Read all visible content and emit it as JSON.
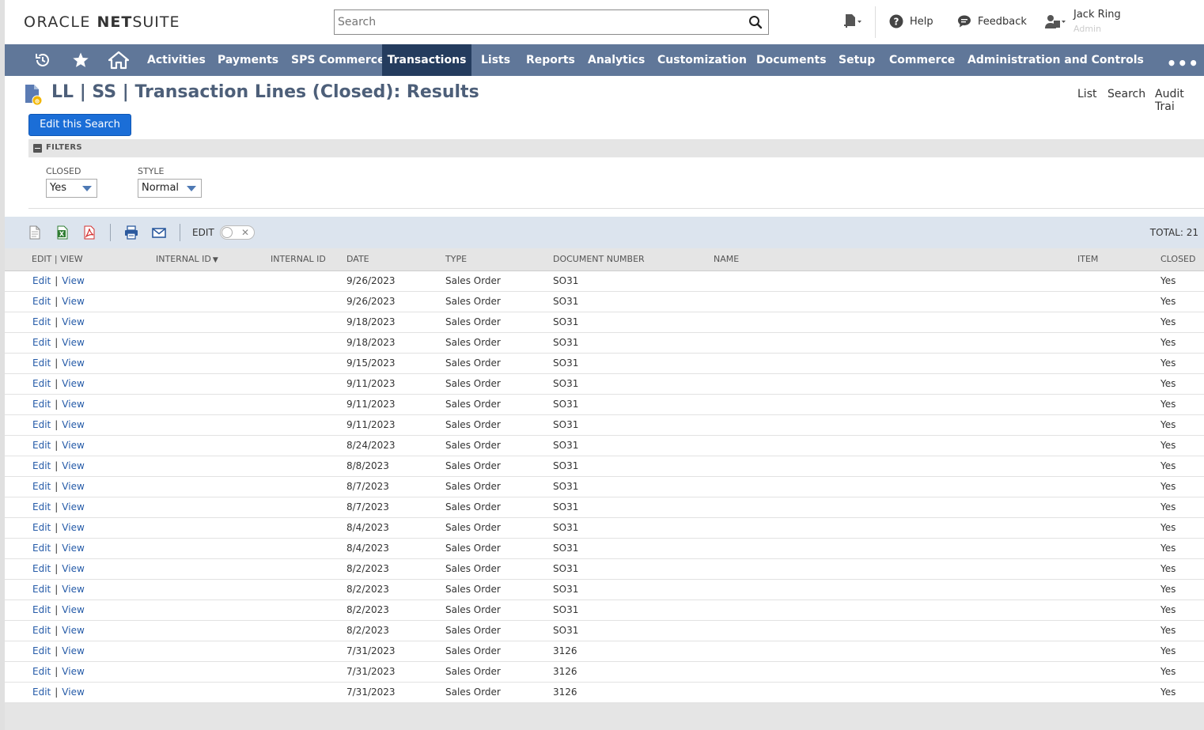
{
  "header": {
    "logo_oracle": "ORACLE",
    "logo_net": "NET",
    "logo_suite": "SUITE",
    "search_placeholder": "Search",
    "help_label": "Help",
    "feedback_label": "Feedback",
    "user_name": "Jack Ring",
    "user_role": "Admin"
  },
  "nav": {
    "items": [
      "Activities",
      "Payments",
      "SPS Commerce",
      "Transactions",
      "Lists",
      "Reports",
      "Analytics",
      "Customization",
      "Documents",
      "Setup",
      "Commerce",
      "Administration and Controls"
    ],
    "active": "Transactions",
    "more_label": "•••"
  },
  "page": {
    "title": "LL | SS | Transaction Lines (Closed): Results",
    "links": [
      "List",
      "Search",
      "Audit Trai"
    ],
    "edit_search_label": "Edit this Search"
  },
  "filters": {
    "section_label": "FILTERS",
    "closed_label": "CLOSED",
    "closed_value": "Yes",
    "style_label": "STYLE",
    "style_value": "Normal"
  },
  "toolbar": {
    "edit_label": "EDIT",
    "total_label": "TOTAL: 21"
  },
  "table": {
    "columns": [
      "EDIT | VIEW",
      "INTERNAL ID",
      "INTERNAL ID",
      "DATE",
      "TYPE",
      "DOCUMENT NUMBER",
      "NAME",
      "ITEM",
      "CLOSED"
    ],
    "sort_indicator": "▼",
    "edit_label": "Edit",
    "view_label": "View",
    "rows": [
      {
        "date": "9/26/2023",
        "type": "Sales Order",
        "doc": "SO31",
        "closed": "Yes"
      },
      {
        "date": "9/26/2023",
        "type": "Sales Order",
        "doc": "SO31",
        "closed": "Yes"
      },
      {
        "date": "9/18/2023",
        "type": "Sales Order",
        "doc": "SO31",
        "closed": "Yes"
      },
      {
        "date": "9/18/2023",
        "type": "Sales Order",
        "doc": "SO31",
        "closed": "Yes"
      },
      {
        "date": "9/15/2023",
        "type": "Sales Order",
        "doc": "SO31",
        "closed": "Yes"
      },
      {
        "date": "9/11/2023",
        "type": "Sales Order",
        "doc": "SO31",
        "closed": "Yes"
      },
      {
        "date": "9/11/2023",
        "type": "Sales Order",
        "doc": "SO31",
        "closed": "Yes"
      },
      {
        "date": "9/11/2023",
        "type": "Sales Order",
        "doc": "SO31",
        "closed": "Yes"
      },
      {
        "date": "8/24/2023",
        "type": "Sales Order",
        "doc": "SO31",
        "closed": "Yes"
      },
      {
        "date": "8/8/2023",
        "type": "Sales Order",
        "doc": "SO31",
        "closed": "Yes"
      },
      {
        "date": "8/7/2023",
        "type": "Sales Order",
        "doc": "SO31",
        "closed": "Yes"
      },
      {
        "date": "8/7/2023",
        "type": "Sales Order",
        "doc": "SO31",
        "closed": "Yes"
      },
      {
        "date": "8/4/2023",
        "type": "Sales Order",
        "doc": "SO31",
        "closed": "Yes"
      },
      {
        "date": "8/4/2023",
        "type": "Sales Order",
        "doc": "SO31",
        "closed": "Yes"
      },
      {
        "date": "8/2/2023",
        "type": "Sales Order",
        "doc": "SO31",
        "closed": "Yes"
      },
      {
        "date": "8/2/2023",
        "type": "Sales Order",
        "doc": "SO31",
        "closed": "Yes"
      },
      {
        "date": "8/2/2023",
        "type": "Sales Order",
        "doc": "SO31",
        "closed": "Yes"
      },
      {
        "date": "8/2/2023",
        "type": "Sales Order",
        "doc": "SO31",
        "closed": "Yes"
      },
      {
        "date": "7/31/2023",
        "type": "Sales Order",
        "doc": "3126",
        "closed": "Yes"
      },
      {
        "date": "7/31/2023",
        "type": "Sales Order",
        "doc": "3126",
        "closed": "Yes"
      },
      {
        "date": "7/31/2023",
        "type": "Sales Order",
        "doc": "3126",
        "closed": "Yes"
      }
    ]
  },
  "colors": {
    "nav_bg": "#607799",
    "nav_active": "#243c5e",
    "link": "#255ba8",
    "primary_button": "#1b6ed7",
    "title": "#4d5f79"
  }
}
